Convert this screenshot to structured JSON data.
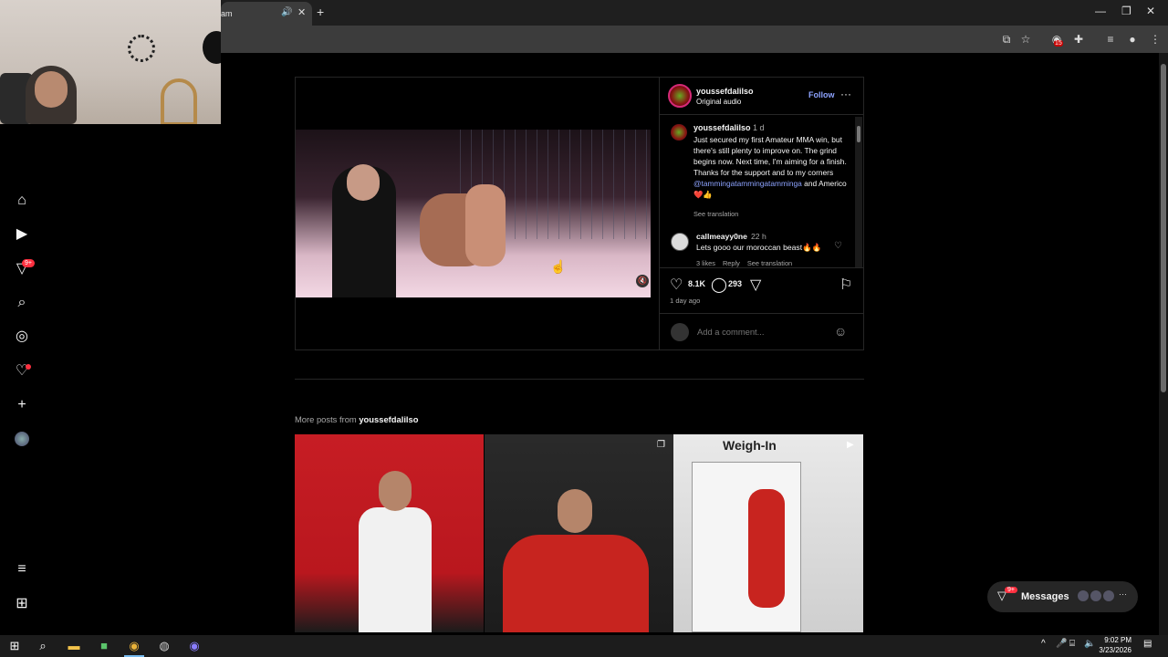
{
  "browser": {
    "tab_title": "am",
    "audio_icon": "speaker-icon",
    "close_glyph": "✕",
    "new_tab_glyph": "+",
    "window_controls": [
      "—",
      "❐",
      "✕"
    ]
  },
  "sidebar": {
    "items": [
      {
        "name": "home-icon",
        "glyph": "⌂"
      },
      {
        "name": "reels-icon",
        "glyph": "▶"
      },
      {
        "name": "direct-icon",
        "glyph": "▽"
      },
      {
        "name": "search-icon",
        "glyph": "⌕"
      },
      {
        "name": "explore-icon",
        "glyph": "◎"
      },
      {
        "name": "notifications-icon",
        "glyph": "♡"
      },
      {
        "name": "create-icon",
        "glyph": "+"
      }
    ],
    "notif_badge": "9+",
    "more_glyph": "≡",
    "meta_glyph": "⊞"
  },
  "post": {
    "header": {
      "username": "youssefdalilso",
      "subtitle": "Original audio",
      "follow_label": "Follow",
      "more_glyph": "···"
    },
    "caption": {
      "username": "youssefdalilso",
      "time": "1 d",
      "text_before": "Just secured my first Amateur MMA win, but there's still plenty to improve on. The grind begins now. Next time, I'm aiming for a finish. Thanks for the support and to my corners ",
      "mention": "@tammingatammingatamminga",
      "text_after": " and Americo ❤️👍",
      "see_translation": "See translation"
    },
    "comment": {
      "username": "callmeayy0ne",
      "time": "22 h",
      "text": "Lets gooo our moroccan beast🔥🔥",
      "likes": "3 likes",
      "reply": "Reply",
      "see_translation": "See translation"
    },
    "actions": {
      "like_count": "8.1K",
      "comment_count": "293"
    },
    "time_ago": "1 day ago",
    "add_comment_placeholder": "Add a comment..."
  },
  "more_posts": {
    "label": "More posts from ",
    "username": "youssefdalilso",
    "thumb3_text": "Weigh-In"
  },
  "messages": {
    "label": "Messages",
    "badge": "9+"
  },
  "taskbar": {
    "time": "9:02 PM",
    "date": "3/23/2026"
  }
}
